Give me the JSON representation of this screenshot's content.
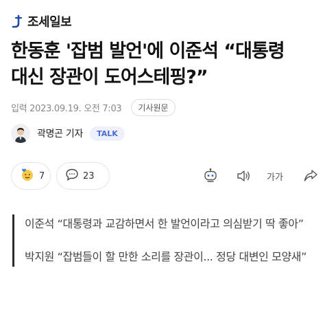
{
  "brand": {
    "name": "조세일보",
    "logo_icon": "joseilbo-logo-icon",
    "accent": "#1f4aa8"
  },
  "article": {
    "title_line1": "한동훈 '잡범 발언'에 이준석 “대통령",
    "title_line2": "대신 장관이 도어스테핑?”",
    "date": "입력 2023.09.19. 오전 7:03",
    "original_button": "기사원문"
  },
  "reporter": {
    "name": "곽명곤 기자",
    "talk_label": "TALK",
    "avatar_icon": "reporter-avatar"
  },
  "actions": {
    "like_icon": "like-emoji-icon",
    "like_count": "7",
    "comment_icon": "comment-bubble-icon",
    "comment_count": "23",
    "summary_robot_icon": "robot-icon",
    "audio_icon": "audio-icon",
    "font_size_label": "가가",
    "share_icon": "share-icon"
  },
  "summary": {
    "quote1": "이준석 “대통령과 교감하면서 한 발언이라고 의심받기 딱 좋아”",
    "quote2": "박지원 “잡범들이 할 만한 소리를 장관이... 정당 대변인 모양새”"
  }
}
